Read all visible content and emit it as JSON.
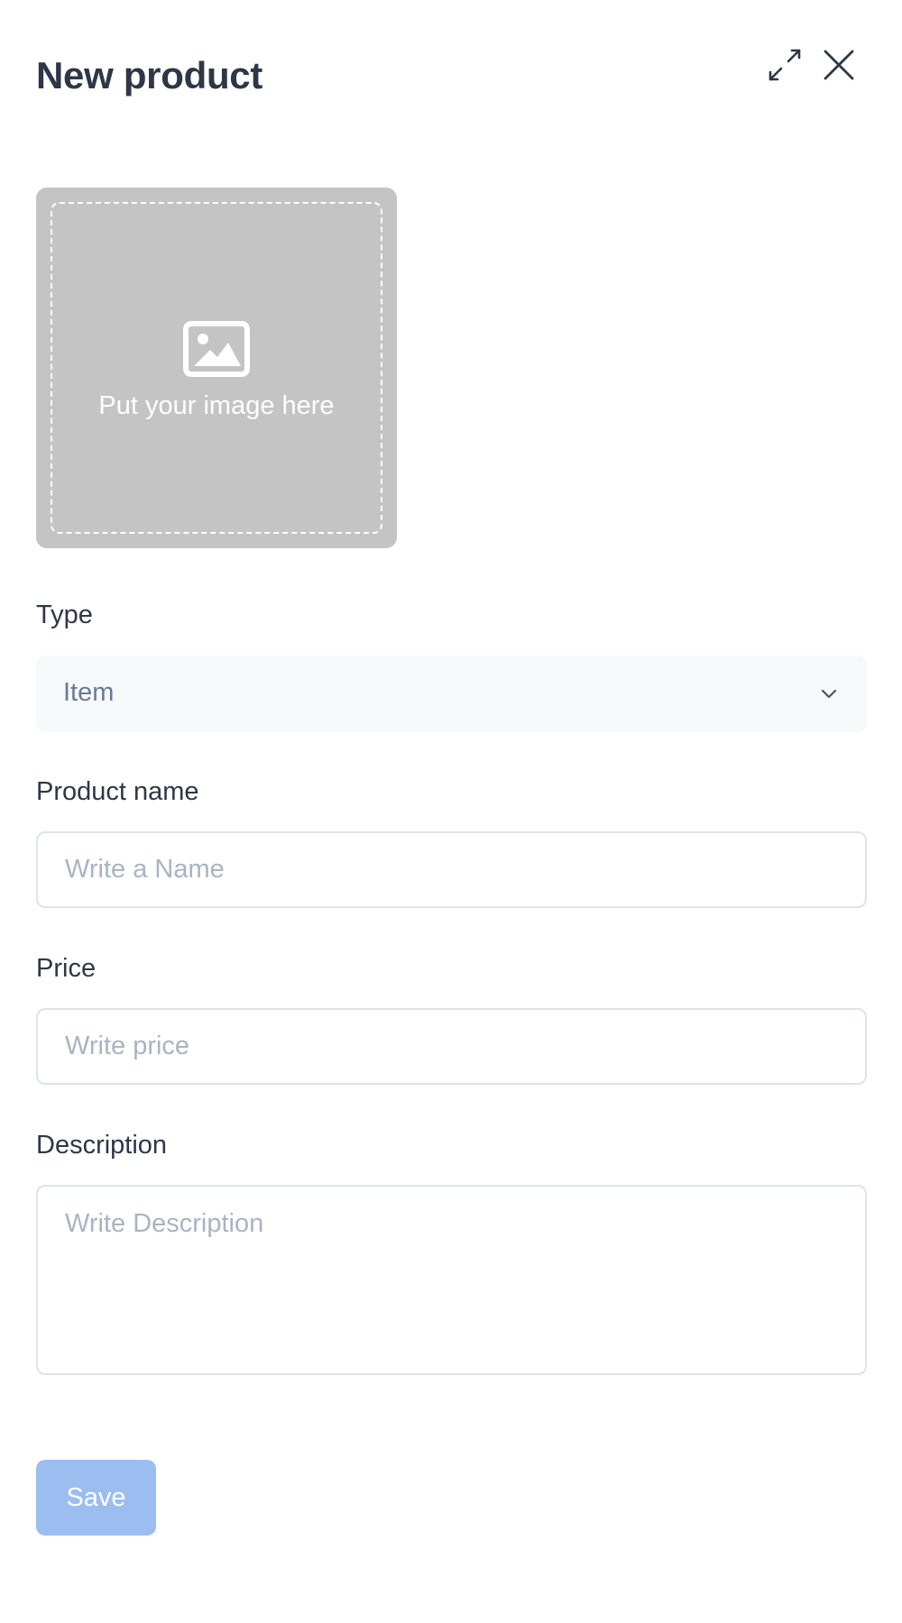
{
  "header": {
    "title": "New product",
    "expand_icon": "expand-arrows-icon",
    "close_icon": "close-icon"
  },
  "image_upload": {
    "icon": "image-icon",
    "text": "Put your image here"
  },
  "type_field": {
    "label": "Type",
    "value": "Item"
  },
  "name_field": {
    "label": "Product name",
    "value": "",
    "placeholder": "Write a Name"
  },
  "price_field": {
    "label": "Price",
    "value": "",
    "placeholder": "Write price"
  },
  "description_field": {
    "label": "Description",
    "value": "",
    "placeholder": "Write Description"
  },
  "actions": {
    "save_label": "Save"
  },
  "colors": {
    "text": "#2d3748",
    "placeholder": "#a8b4c4",
    "image_bg": "#c4c4c4",
    "select_bg": "#f7f8fa",
    "save_button": "#9bbdf0"
  }
}
